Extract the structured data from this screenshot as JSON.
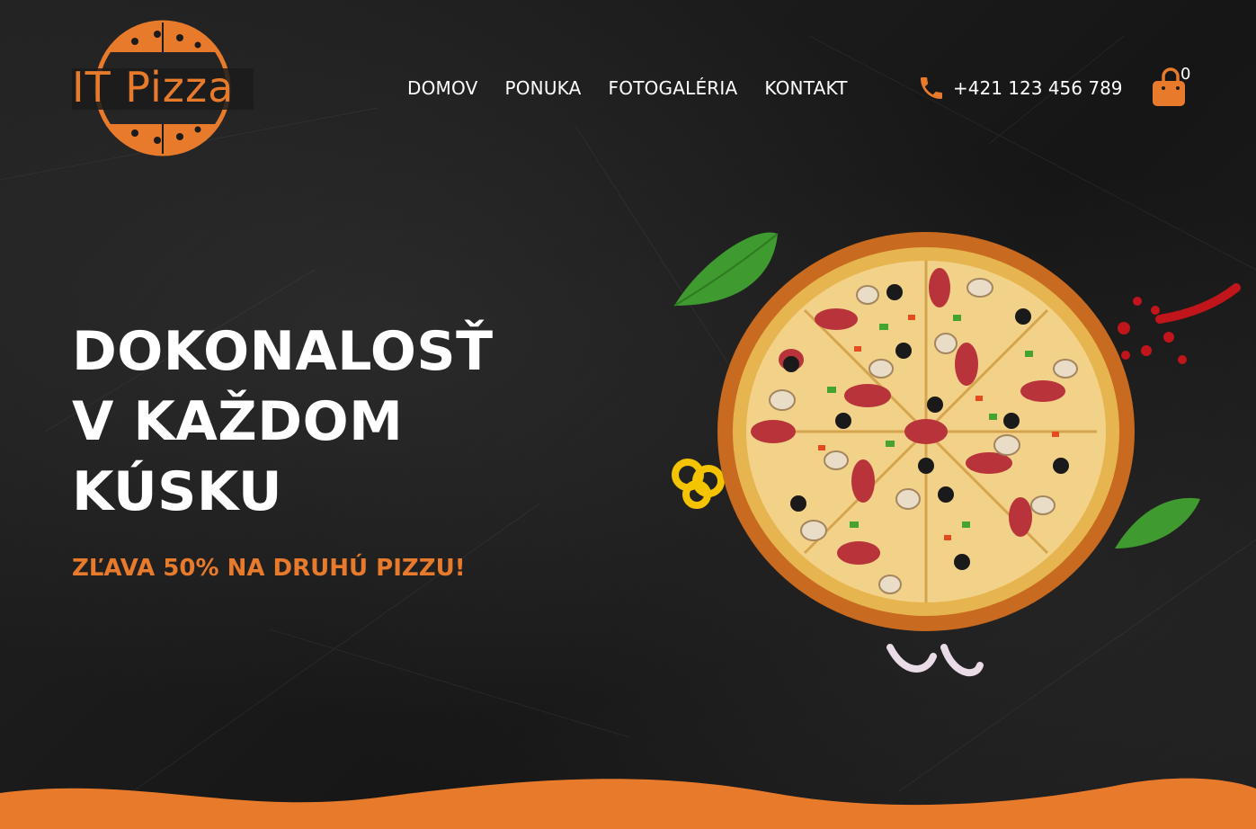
{
  "brand": {
    "logo_text": "IT Pizza",
    "accent_color": "#e87a2c"
  },
  "nav": {
    "items": [
      {
        "label": "DOMOV"
      },
      {
        "label": "PONUKA"
      },
      {
        "label": "FOTOGALÉRIA"
      },
      {
        "label": "KONTAKT"
      }
    ]
  },
  "contact": {
    "phone": "+421 123 456 789",
    "icon": "phone-icon"
  },
  "cart": {
    "count": "0",
    "icon": "shopping-bag-icon"
  },
  "hero": {
    "title_lines": [
      "DOKONALOSŤ",
      "V KAŽDOM",
      "KÚSKU"
    ],
    "subtitle": "ZĽAVA 50% NA DRUHÚ PIZZU!"
  }
}
